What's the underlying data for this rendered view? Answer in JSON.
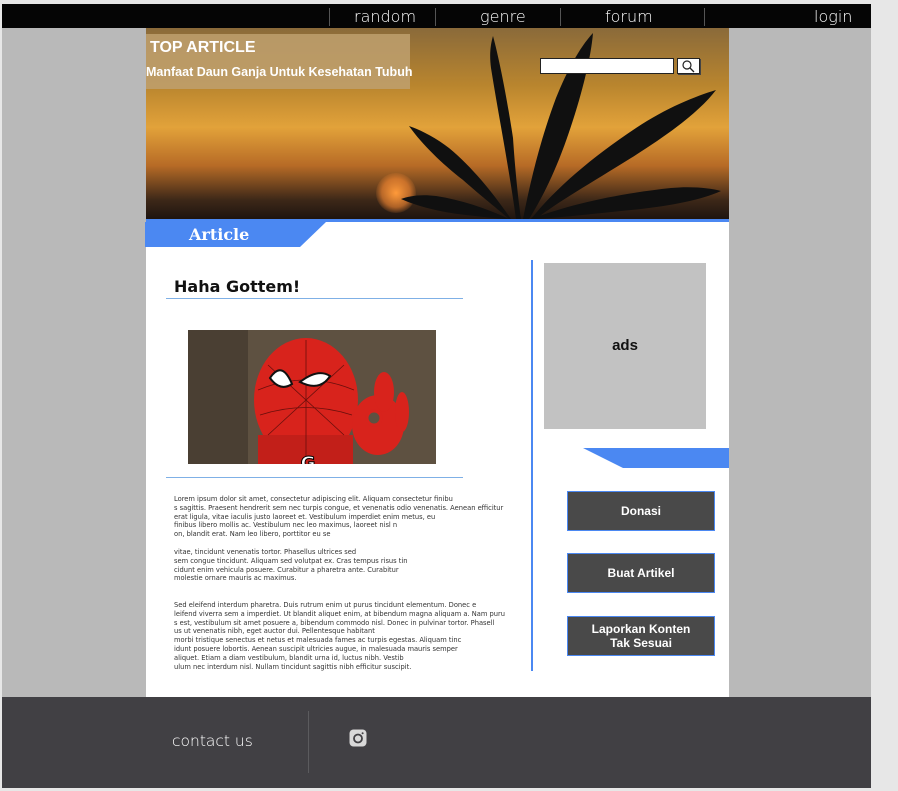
{
  "nav": {
    "random": "random",
    "genre": "genre",
    "forum": "forum",
    "login": "login"
  },
  "hero": {
    "top_label": "TOP ARTICLE",
    "top_title": "Manfaat Daun Ganja Untuk Kesehatan Tubuh",
    "search_value": ""
  },
  "section_label": "Article",
  "article": {
    "title": "Haha Gottem!",
    "paragraph1": [
      "Lorem ipsum dolor sit amet, consectetur adipiscing elit. Aliquam consectetur finibu",
      "s sagittis. Praesent hendrerit sem nec turpis congue, et venenatis odio venenatis. Aenean efficitur",
      " erat ligula, vitae iaculis justo laoreet et. Vestibulum imperdiet enim metus, eu",
      " finibus libero mollis ac. Vestibulum nec leo maximus, laoreet nisl n",
      "on, blandit erat. Nam leo libero, porttitor eu se"
    ],
    "paragraph2": [
      "vitae, tincidunt venenatis tortor. Phasellus ultrices sed",
      " sem congue tincidunt. Aliquam sed volutpat ex. Cras tempus risus tin",
      "cidunt enim vehicula posuere. Curabitur a pharetra ante. Curabitur",
      " molestie ornare mauris ac maximus."
    ],
    "paragraph3": [
      "Sed eleifend interdum pharetra. Duis rutrum enim ut purus tincidunt elementum. Donec e",
      "leifend viverra sem a imperdiet. Ut blandit aliquet enim, at bibendum magna aliquam a. Nam puru",
      "s est, vestibulum sit amet posuere a, bibendum commodo nisl. Donec in pulvinar tortor. Phasell",
      "us ut venenatis nibh, eget auctor dui. Pellentesque habitant",
      "morbi tristique senectus et netus et malesuada fames ac turpis egestas. Aliquam tinc",
      "idunt posuere lobortis. Aenean suscipit ultricies augue, in malesuada mauris semper",
      "aliquet. Etiam a diam vestibulum, blandit urna id, luctus nibh. Vestib",
      "ulum nec interdum nisl. Nullam tincidunt sagittis nibh efficitur suscipit."
    ]
  },
  "sidebar": {
    "ads_label": "ads",
    "buttons": {
      "donate": "Donasi",
      "create_article": "Buat Artikel",
      "report_line1": "Laporkan Konten",
      "report_line2": "Tak Sesuai"
    }
  },
  "footer": {
    "contact": "contact us",
    "social_icon": "instagram-icon"
  },
  "colors": {
    "accent": "#4b88f2",
    "nav_bg": "#050505",
    "footer_bg": "#414044",
    "button_bg": "#494949",
    "ads_bg": "#c2c2c2"
  }
}
